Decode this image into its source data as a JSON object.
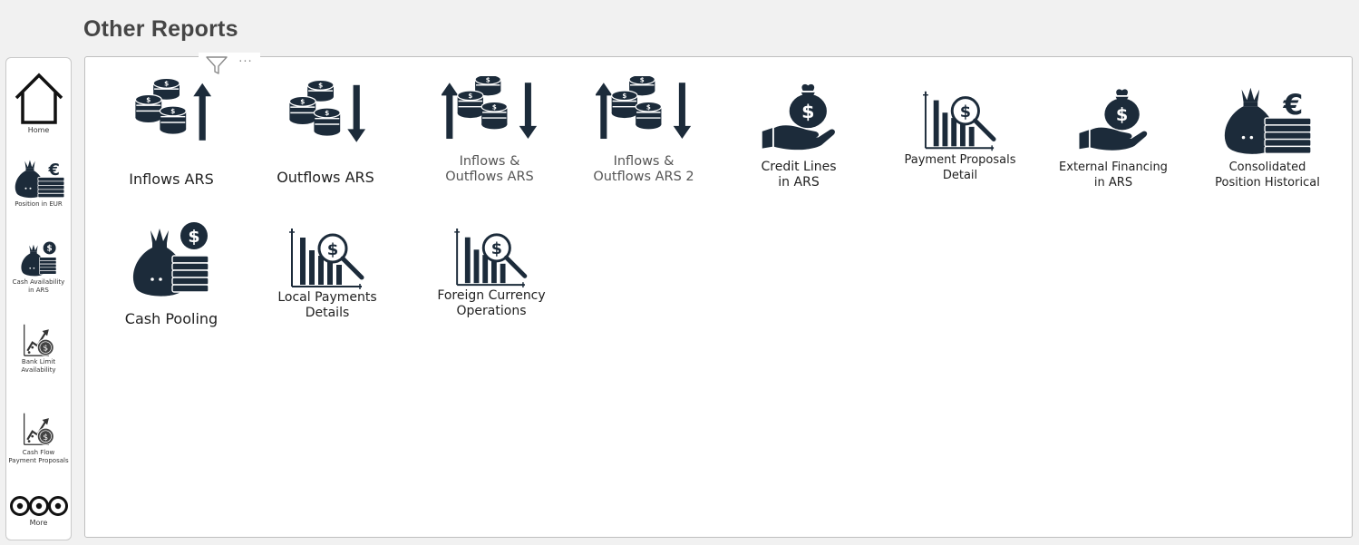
{
  "page": {
    "title": "Other Reports"
  },
  "sidebar": {
    "items": [
      {
        "label": "Home",
        "icon": "home-icon"
      },
      {
        "label": "Position in EUR",
        "icon": "money-bag-euro-icon"
      },
      {
        "label": "Cash Availability\nin ARS",
        "icon": "money-bag-dollar-icon"
      },
      {
        "label": "Bank Limit\nAvailability",
        "icon": "growth-chart-dollar-icon"
      },
      {
        "label": "Cash Flow\nPayment Proposals",
        "icon": "growth-chart-dollar-icon"
      },
      {
        "label": "More",
        "icon": "more-circles-icon"
      }
    ]
  },
  "visual_header": {
    "filter_icon": "filter-icon",
    "more_label": "···"
  },
  "reports": [
    {
      "label": "Inflows ARS",
      "icon": "coins-arrow-up-icon"
    },
    {
      "label": "Outflows ARS",
      "icon": "coins-arrow-down-icon"
    },
    {
      "label": "Inflows &\nOutflows ARS",
      "icon": "coins-arrows-both-icon"
    },
    {
      "label": "Inflows &\nOutflows ARS 2",
      "icon": "coins-arrows-both-icon"
    },
    {
      "label": "Credit Lines\nin ARS",
      "icon": "hand-money-bag-icon"
    },
    {
      "label": "Payment Proposals\nDetail",
      "icon": "chart-magnifier-dollar-icon"
    },
    {
      "label": "External Financing\nin ARS",
      "icon": "hand-money-bag-icon"
    },
    {
      "label": "Consolidated\nPosition Historical",
      "icon": "money-bag-euro-icon"
    },
    {
      "label": "Cash Pooling",
      "icon": "money-bag-dollar-icon"
    },
    {
      "label": "Local Payments\nDetails",
      "icon": "chart-magnifier-dollar-icon"
    },
    {
      "label": "Foreign Currency\nOperations",
      "icon": "chart-magnifier-dollar-icon"
    }
  ],
  "colors": {
    "icon_dark": "#1c2b3a",
    "text": "#1f1f1f",
    "title": "#454545"
  }
}
